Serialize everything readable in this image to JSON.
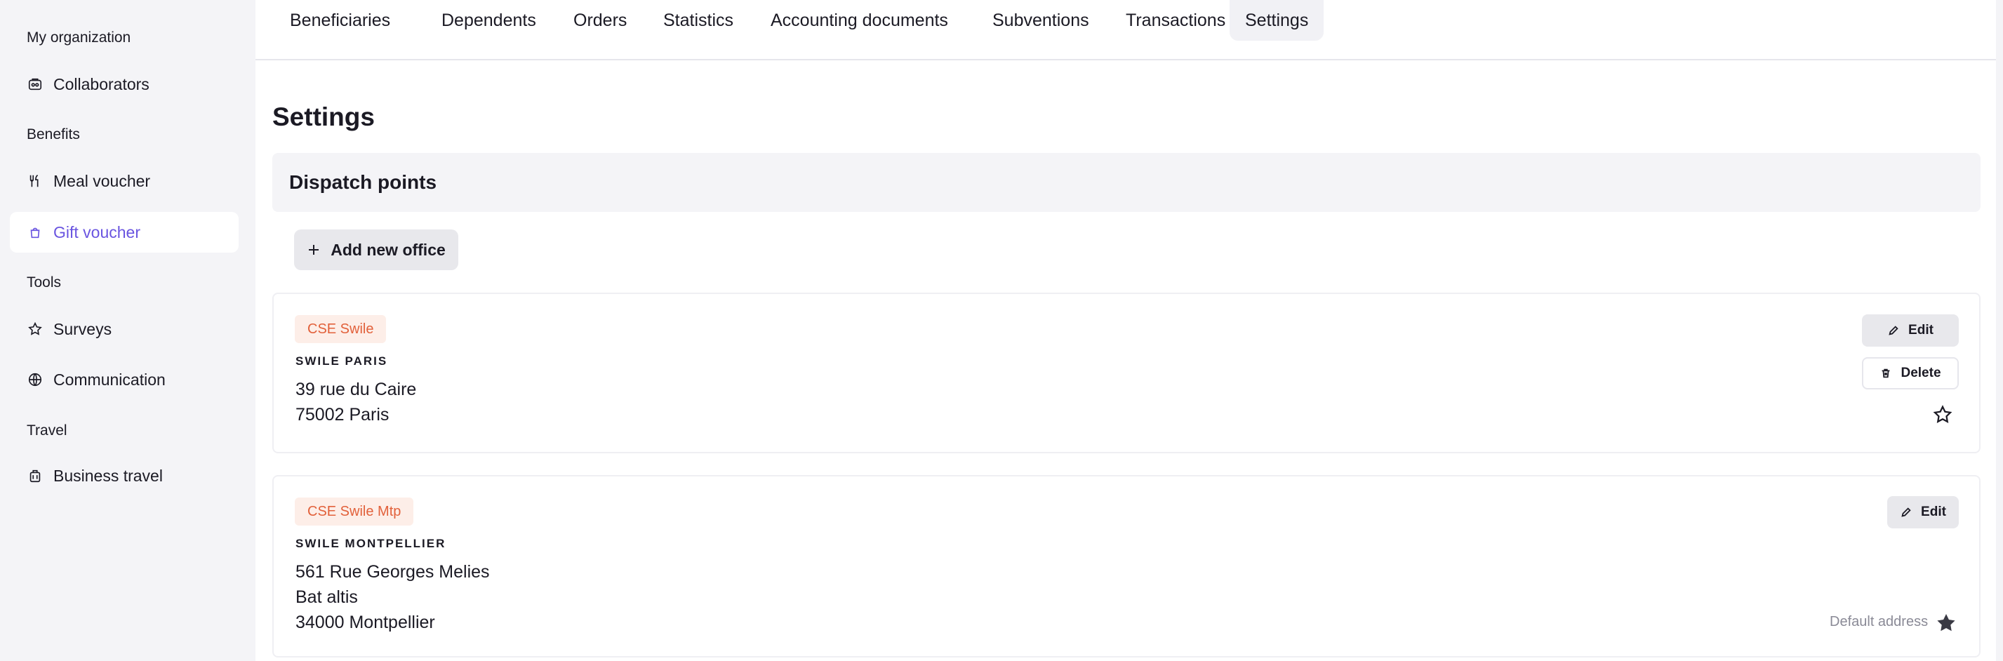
{
  "sidebar": {
    "sections": [
      {
        "label": "My organization"
      },
      {
        "label": "Benefits"
      },
      {
        "label": "Tools"
      },
      {
        "label": "Travel"
      }
    ],
    "items": [
      {
        "label": "Collaborators",
        "icon": "collaborators-icon"
      },
      {
        "label": "Meal voucher",
        "icon": "utensils-icon"
      },
      {
        "label": "Gift voucher",
        "icon": "gift-bag-icon",
        "active": true
      },
      {
        "label": "Surveys",
        "icon": "star-icon"
      },
      {
        "label": "Communication",
        "icon": "globe-icon"
      },
      {
        "label": "Business travel",
        "icon": "suitcase-icon"
      }
    ]
  },
  "tabs": [
    {
      "label": "Beneficiaries"
    },
    {
      "label": "Dependents"
    },
    {
      "label": "Orders"
    },
    {
      "label": "Statistics"
    },
    {
      "label": "Accounting documents"
    },
    {
      "label": "Subventions"
    },
    {
      "label": "Transactions"
    },
    {
      "label": "Settings",
      "active": true
    }
  ],
  "main": {
    "title": "Settings",
    "section_title": "Dispatch points",
    "add_label": "Add new office",
    "offices": [
      {
        "badge": "CSE Swile",
        "name": "SWILE PARIS",
        "address": [
          "39 rue du Caire",
          "75002 Paris"
        ],
        "edit_label": "Edit",
        "delete_label": "Delete",
        "is_default": false
      },
      {
        "badge": "CSE Swile Mtp",
        "name": "SWILE MONTPELLIER",
        "address": [
          "561 Rue Georges Melies",
          "Bat altis",
          "34000 Montpellier"
        ],
        "edit_label": "Edit",
        "default_label": "Default address",
        "is_default": true
      }
    ]
  },
  "colors": {
    "accent": "#6a55e0",
    "badge_text": "#e2613b",
    "badge_bg": "#fdeee8",
    "sidebar_bg": "#f4f4f7"
  }
}
